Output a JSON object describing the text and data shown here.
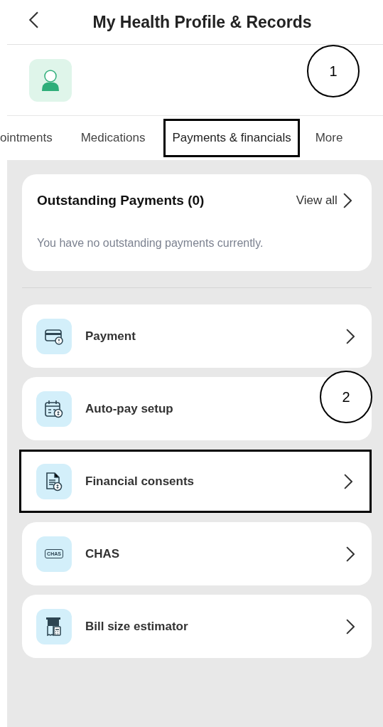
{
  "header": {
    "title": "My Health Profile & Records"
  },
  "tabs": [
    {
      "label": "ointments",
      "selected": false,
      "highlighted": false
    },
    {
      "label": "Medications",
      "selected": false,
      "highlighted": false
    },
    {
      "label": "Payments & financials",
      "selected": true,
      "highlighted": true
    },
    {
      "label": "More",
      "selected": false,
      "highlighted": false
    }
  ],
  "outstanding": {
    "title": "Outstanding Payments (0)",
    "link": "View all",
    "message": "You have no outstanding payments currently."
  },
  "menu": [
    {
      "kind": "card",
      "label": "Payment",
      "highlighted": false,
      "chevron": true
    },
    {
      "kind": "calendar",
      "label": "Auto-pay setup",
      "highlighted": false,
      "chevron": false
    },
    {
      "kind": "document",
      "label": "Financial consents",
      "highlighted": true,
      "chevron": true
    },
    {
      "kind": "chas",
      "label": "CHAS",
      "icon_text": "CHAS",
      "highlighted": false,
      "chevron": true
    },
    {
      "kind": "bill",
      "label": "Bill size estimator",
      "highlighted": false,
      "chevron": true
    }
  ],
  "callouts": [
    {
      "label": "1"
    },
    {
      "label": "2"
    }
  ]
}
